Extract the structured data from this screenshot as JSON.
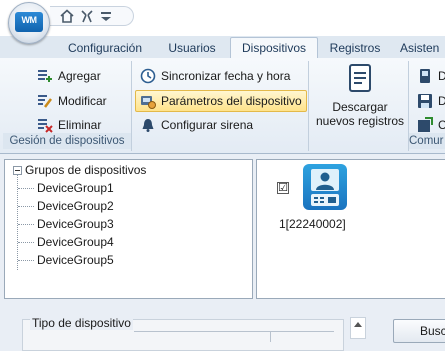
{
  "quick_access": {
    "icons": [
      "home-icon",
      "tools-icon",
      "dropdown-icon"
    ]
  },
  "tabs": [
    {
      "label": "Configuración",
      "active": false
    },
    {
      "label": "Usuarios",
      "active": false
    },
    {
      "label": "Dispositivos",
      "active": true
    },
    {
      "label": "Registros",
      "active": false
    },
    {
      "label": "Asisten",
      "active": false
    }
  ],
  "ribbon": {
    "device_management": {
      "label": "Gesión de dispositivos",
      "add": "Agregar",
      "modify": "Modificar",
      "delete": "Eliminar"
    },
    "device_actions": {
      "sync_time": "Sincronizar fecha y hora",
      "device_params": "Parámetros del dispositivo",
      "config_siren": "Configurar sirena"
    },
    "download": {
      "line1": "Descargar",
      "line2": "nuevos registros"
    },
    "communication": {
      "label": "Comur",
      "item1": "D",
      "item2": "D",
      "item3": "C"
    }
  },
  "tree": {
    "root": "Grupos de dispositivos",
    "groups": [
      "DeviceGroup1",
      "DeviceGroup2",
      "DeviceGroup3",
      "DeviceGroup4",
      "DeviceGroup5"
    ]
  },
  "device": {
    "name": "1[22240002]",
    "checked": true,
    "check_mark": "☑"
  },
  "bottom": {
    "type_label": "Tipo de dispositivo",
    "search_button": "Busc"
  },
  "colors": {
    "accent": "#1a73bf",
    "highlight": "#ffe38a",
    "ribbon_bg": "#e3ebf4"
  }
}
